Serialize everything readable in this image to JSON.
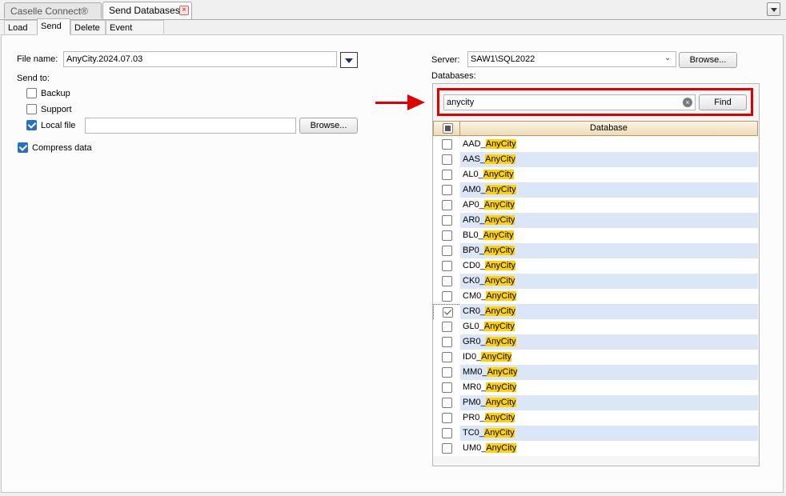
{
  "doc_tabs": [
    {
      "label": "Caselle Connect®",
      "active": false
    },
    {
      "label": "Send Databases",
      "active": true
    }
  ],
  "sub_tabs": [
    "Load",
    "Send",
    "Delete",
    "Event Viewer"
  ],
  "active_sub_tab": "Send",
  "left": {
    "file_name_label": "File name:",
    "file_name_value": "AnyCity.2024.07.03",
    "send_to_label": "Send to:",
    "backup_label": "Backup",
    "backup_checked": false,
    "support_label": "Support",
    "support_checked": false,
    "local_file_label": "Local file",
    "local_file_checked": true,
    "local_file_value": "",
    "browse_label": "Browse...",
    "compress_label": "Compress data",
    "compress_checked": true
  },
  "right": {
    "server_label": "Server:",
    "server_value": "SAW1\\SQL2022",
    "server_browse_label": "Browse...",
    "databases_label": "Databases:",
    "search_value": "anycity",
    "find_label": "Find",
    "column_header": "Database",
    "rows": [
      {
        "prefix": "AAD_",
        "match": "AnyCity",
        "checked": false
      },
      {
        "prefix": "AAS_",
        "match": "AnyCity",
        "checked": false
      },
      {
        "prefix": "AL0_",
        "match": "AnyCity",
        "checked": false
      },
      {
        "prefix": "AM0_",
        "match": "AnyCity",
        "checked": false
      },
      {
        "prefix": "AP0_",
        "match": "AnyCity",
        "checked": false
      },
      {
        "prefix": "AR0_",
        "match": "AnyCity",
        "checked": false
      },
      {
        "prefix": "BL0_",
        "match": "AnyCity",
        "checked": false
      },
      {
        "prefix": "BP0_",
        "match": "AnyCity",
        "checked": false
      },
      {
        "prefix": "CD0_",
        "match": "AnyCity",
        "checked": false
      },
      {
        "prefix": "CK0_",
        "match": "AnyCity",
        "checked": false
      },
      {
        "prefix": "CM0_",
        "match": "AnyCity",
        "checked": false
      },
      {
        "prefix": "CR0_",
        "match": "AnyCity",
        "checked": true
      },
      {
        "prefix": "GL0_",
        "match": "AnyCity",
        "checked": false
      },
      {
        "prefix": "GR0_",
        "match": "AnyCity",
        "checked": false
      },
      {
        "prefix": "ID0_",
        "match": "AnyCity",
        "checked": false
      },
      {
        "prefix": "MM0_",
        "match": "AnyCity",
        "checked": false
      },
      {
        "prefix": "MR0_",
        "match": "AnyCity",
        "checked": false
      },
      {
        "prefix": "PM0_",
        "match": "AnyCity",
        "checked": false
      },
      {
        "prefix": "PR0_",
        "match": "AnyCity",
        "checked": false
      },
      {
        "prefix": "TC0_",
        "match": "AnyCity",
        "checked": false
      },
      {
        "prefix": "UM0_",
        "match": "AnyCity",
        "checked": false
      }
    ]
  },
  "colors": {
    "highlight": "#ffd200",
    "alt_row": "#dbe6f6",
    "annotation_red": "#e00000",
    "check_blue": "#2b6fc4"
  }
}
